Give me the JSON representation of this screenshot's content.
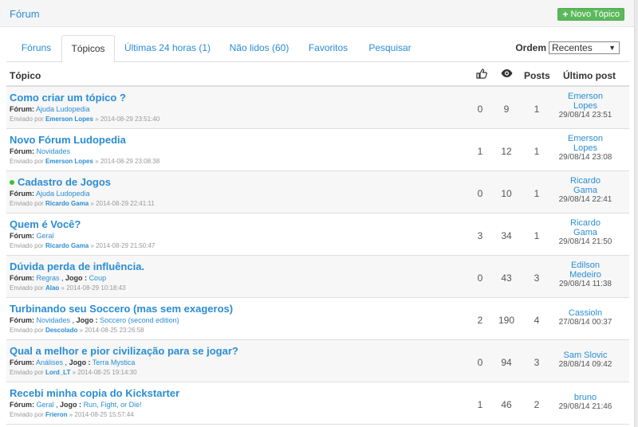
{
  "header": {
    "title": "Fórum",
    "new_topic_label": "Novo Tópico"
  },
  "tabs": [
    {
      "label": "Fóruns"
    },
    {
      "label": "Tópicos",
      "active": true
    },
    {
      "label": "Últimas 24 horas (1)"
    },
    {
      "label": "Não lidos (60)"
    },
    {
      "label": "Favoritos"
    },
    {
      "label": "Pesquisar"
    }
  ],
  "ordem": {
    "label": "Ordem",
    "selected": "Recentes"
  },
  "columns": {
    "topic": "Tópico",
    "posts": "Posts",
    "last": "Último post",
    "likes_icon": "thumbs-up-icon",
    "views_icon": "eye-icon"
  },
  "strings": {
    "forum_prefix": "Fórum:",
    "game_prefix": "Jogo :",
    "sent_by": "Enviado por"
  },
  "topics": [
    {
      "title": "Como criar um tópico ?",
      "forum": "Ajuda Ludopedia",
      "game": "",
      "author": "Emerson Lopes",
      "sent": "» 2014-08-29 23:51:40",
      "likes": "0",
      "views": "9",
      "posts": "1",
      "last_user_1": "Emerson",
      "last_user_2": "Lopes",
      "last_date": "29/08/14 23:51",
      "new": false
    },
    {
      "title": "Novo Fórum Ludopedia",
      "forum": "Novidades",
      "game": "",
      "author": "Emerson Lopes",
      "sent": "» 2014-08-29 23:08:38",
      "likes": "1",
      "views": "12",
      "posts": "1",
      "last_user_1": "Emerson",
      "last_user_2": "Lopes",
      "last_date": "29/08/14 23:08",
      "new": false
    },
    {
      "title": "Cadastro de Jogos",
      "forum": "Ajuda Ludopedia",
      "game": "",
      "author": "Ricardo Gama",
      "sent": "» 2014-08-29 22:41:11",
      "likes": "0",
      "views": "10",
      "posts": "1",
      "last_user_1": "Ricardo",
      "last_user_2": "Gama",
      "last_date": "29/08/14 22:41",
      "new": true
    },
    {
      "title": "Quem é Você?",
      "forum": "Geral",
      "game": "",
      "author": "Ricardo Gama",
      "sent": "» 2014-08-29 21:50:47",
      "likes": "3",
      "views": "34",
      "posts": "1",
      "last_user_1": "Ricardo",
      "last_user_2": "Gama",
      "last_date": "29/08/14 21:50",
      "new": false
    },
    {
      "title": "Dúvida perda de influência.",
      "forum": "Regras",
      "game": "Coup",
      "author": "Alao",
      "sent": "» 2014-08-29 10:18:43",
      "likes": "0",
      "views": "43",
      "posts": "3",
      "last_user_1": "Edilson",
      "last_user_2": "Medeiro",
      "last_date": "29/08/14 11:38",
      "new": false
    },
    {
      "title": "Turbinando seu Soccero (mas sem exageros)",
      "forum": "Novidades",
      "game": "Soccero (second edition)",
      "author": "Descolado",
      "sent": "» 2014-08-25 23:26:58",
      "likes": "2",
      "views": "190",
      "posts": "4",
      "last_user_1": "Cassioln",
      "last_user_2": "",
      "last_date": "27/08/14 00:37",
      "new": false
    },
    {
      "title": "Qual a melhor e pior civilização para se jogar?",
      "forum": "Análises",
      "game": "Terra Mystica",
      "author": "Lord_LT",
      "sent": "» 2014-08-25 19:14:30",
      "likes": "0",
      "views": "94",
      "posts": "3",
      "last_user_1": "Sam Slovic",
      "last_user_2": "",
      "last_date": "28/08/14 09:42",
      "new": false
    },
    {
      "title": "Recebi minha copia do Kickstarter",
      "forum": "Geral",
      "game": "Run, Fight, or Die!",
      "author": "Frieron",
      "sent": "» 2014-08-25 15:57:44",
      "likes": "1",
      "views": "46",
      "posts": "2",
      "last_user_1": "bruno",
      "last_user_2": "",
      "last_date": "29/08/14 21:46",
      "new": false
    }
  ]
}
